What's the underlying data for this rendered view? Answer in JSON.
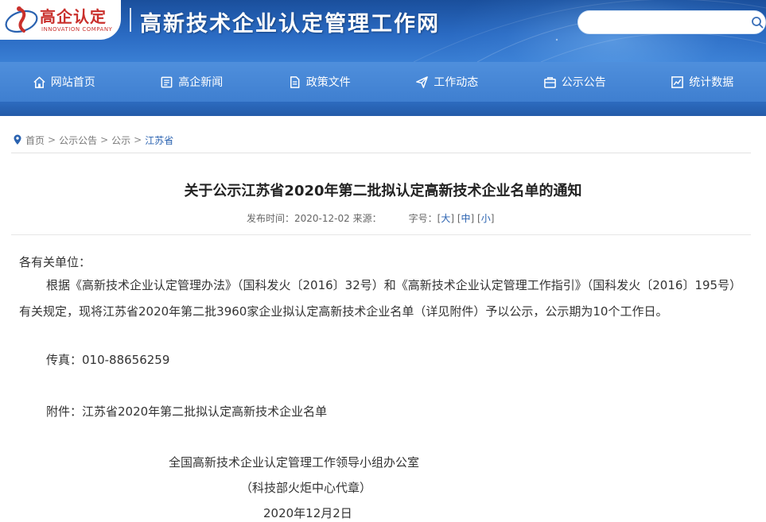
{
  "header": {
    "logo_cn": "高企认定",
    "logo_en": "INNOVATION COMPANY",
    "site_title": "高新技术企业认定管理工作网",
    "search": {
      "value": "",
      "placeholder": ""
    }
  },
  "nav": {
    "items": [
      {
        "label": "网站首页",
        "icon": "home-icon"
      },
      {
        "label": "高企新闻",
        "icon": "news-icon"
      },
      {
        "label": "政策文件",
        "icon": "document-icon"
      },
      {
        "label": "工作动态",
        "icon": "send-icon"
      },
      {
        "label": "公示公告",
        "icon": "bulletin-icon"
      },
      {
        "label": "统计数据",
        "icon": "chart-icon"
      }
    ]
  },
  "breadcrumb": {
    "items": [
      "首页",
      "公示公告",
      "公示",
      "江苏省"
    ],
    "separator": ">"
  },
  "article": {
    "title": "关于公示江苏省2020年第二批拟认定高新技术企业名单的通知",
    "publish_label": "发布时间：",
    "publish_date": "2020-12-02",
    "source_label": "来源：",
    "fontsize_label": "字号：",
    "fontsize_options": [
      "大",
      "中",
      "小"
    ],
    "salutation": "各有关单位：",
    "body": "根据《高新技术企业认定管理办法》（国科发火〔2016〕32号）和《高新技术企业认定管理工作指引》（国科发火〔2016〕195号）有关规定，现将江苏省2020年第二批3960家企业拟认定高新技术企业名单（详见附件）予以公示，公示期为10个工作日。",
    "fax": "传真：010-88656259",
    "attachment": "附件：江苏省2020年第二批拟认定高新技术企业名单",
    "signature_org": "全国高新技术企业认定管理工作领导小组办公室",
    "signature_seal": "（科技部火炬中心代章）",
    "signature_date": "2020年12月2日"
  },
  "colors": {
    "header_blue": "#1a4f9c",
    "nav_blue": "#4f8fdc",
    "logo_red": "#c9302c",
    "link_blue": "#2a62b0"
  }
}
